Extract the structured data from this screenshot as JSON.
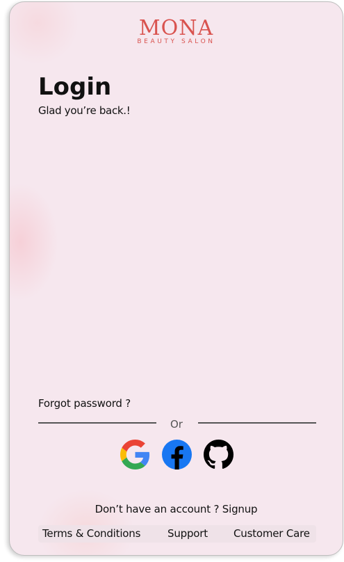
{
  "brand": {
    "name": "MONA",
    "tagline": "BEAUTY SALON",
    "color": "#d9534f"
  },
  "header": {
    "title": "Login",
    "subtitle": "Glad you’re back.!"
  },
  "links": {
    "forgot_password": "Forgot password ?",
    "signup": "Don’t have an account ? Signup"
  },
  "divider": {
    "label": "Or"
  },
  "social": [
    {
      "icon": "google-icon"
    },
    {
      "icon": "facebook-icon",
      "color": "#1877f2"
    },
    {
      "icon": "github-icon"
    }
  ],
  "footer": {
    "terms": "Terms & Conditions",
    "support": "Support",
    "customer_care": "Customer Care"
  },
  "colors": {
    "background": "#f6e7ee",
    "text": "#111111"
  }
}
